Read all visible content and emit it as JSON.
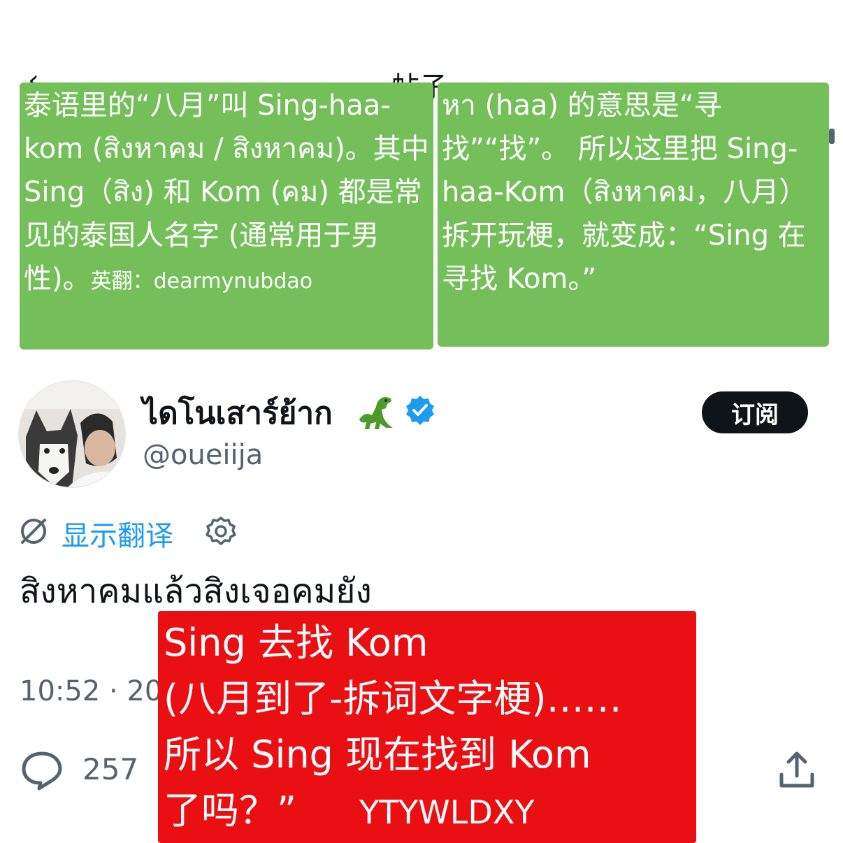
{
  "header": {
    "back_glyph": "‹",
    "title_fragment": "帖子"
  },
  "overlay_left": {
    "text": "泰语里的“八月”叫 Sing-haa-kom (สิงหาคม / สิงหาคม)。其中 Sing（สิง) 和 Kom (คม) 都是常见的泰国人名字 (通常用于男性)。",
    "credit": "英翻：dearmynubdao"
  },
  "overlay_right": {
    "text": "หา (haa) 的意思是“寻找”“找”。 所以这里把 Sing-haa-Kom（สิงหาคม，八月）拆开玩梗，就变成：“Sing 在寻找 Kom。”"
  },
  "profile": {
    "display_name": "ไดโนเสาร์ย้าก",
    "handle": "@oueiija",
    "subscribe_label": "订阅",
    "badge_color": "#1d9bf0"
  },
  "translate": {
    "link_label": "显示翻译"
  },
  "tweet": {
    "text": "สิงหาคมแล้วสิงเจอคมยัง",
    "timestamp": "10:52 · 20"
  },
  "actions": {
    "reply_count": "257"
  },
  "overlay_red": {
    "line1": "Sing 去找 Kom",
    "line2": "(八月到了-拆词文字梗)……",
    "line3": "所以 Sing 现在找到 Kom",
    "line4": "了吗？”",
    "credit": "YTYWLDXY"
  }
}
